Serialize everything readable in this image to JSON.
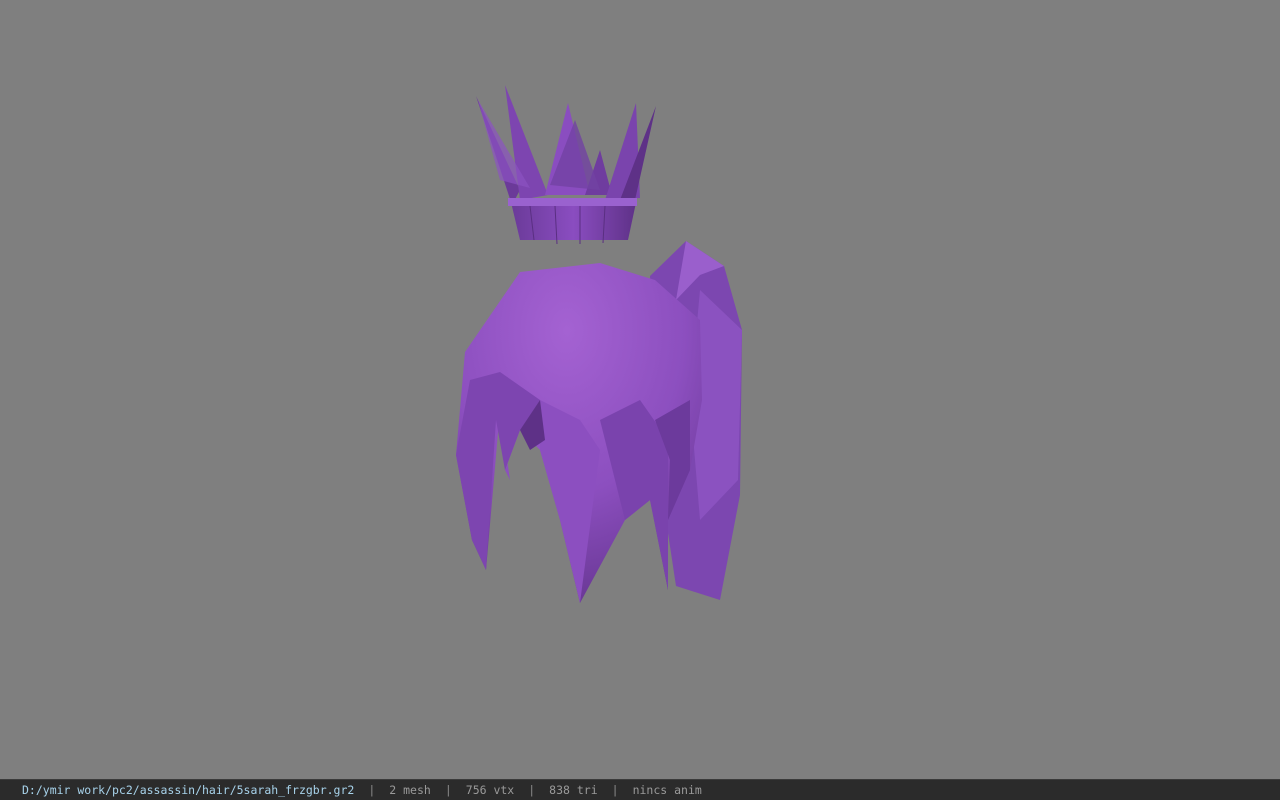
{
  "viewport": {
    "background": "#7f7f7f",
    "model_color": "#9b59c9"
  },
  "status": {
    "file_path": "D:/ymir work/pc2/assassin/hair/5sarah_frzgbr.gr2",
    "separator": "|",
    "mesh": "2 mesh",
    "vertices": "756 vtx",
    "triangles": "838 tri",
    "anim": "nincs anim"
  }
}
